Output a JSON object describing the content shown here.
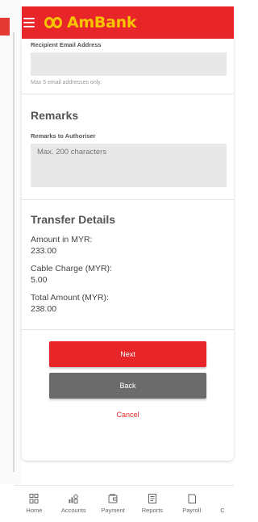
{
  "header": {
    "brand": "AmBank"
  },
  "recipient_email": {
    "label": "Recipient Email Address",
    "value": "",
    "hint": "Max 5 email addresses only."
  },
  "remarks": {
    "title": "Remarks",
    "label": "Remarks to Authoriser",
    "placeholder": "Max. 200 characters"
  },
  "transfer_details": {
    "title": "Transfer Details",
    "items": [
      {
        "label": "Amount in MYR:",
        "value": "233.00"
      },
      {
        "label": "Cable Charge (MYR):",
        "value": "5.00"
      },
      {
        "label": "Total Amount (MYR):",
        "value": "238.00"
      }
    ]
  },
  "actions": {
    "next_label": "Next",
    "back_label": "Back",
    "cancel_label": "Cancel"
  },
  "bottom_nav": {
    "items": [
      {
        "label": "Home",
        "icon": "home-icon"
      },
      {
        "label": "Accounts",
        "icon": "accounts-icon"
      },
      {
        "label": "Payment",
        "icon": "payment-icon"
      },
      {
        "label": "Reports",
        "icon": "reports-icon"
      },
      {
        "label": "Payroll",
        "icon": "payroll-icon"
      },
      {
        "label": "C",
        "icon": "more-icon"
      }
    ]
  },
  "colors": {
    "brand_red": "#e8262a",
    "brand_yellow": "#f6c500",
    "back_grey": "#6b6b6b"
  }
}
